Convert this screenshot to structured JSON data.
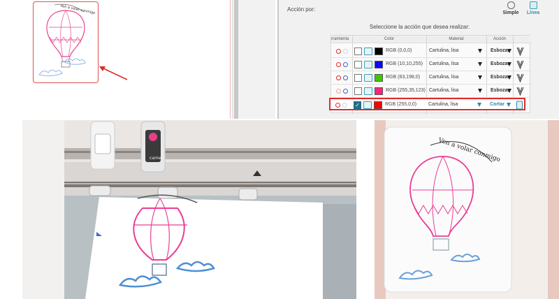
{
  "accent_colors": {
    "selection_red": "#e02a2a",
    "line_teal": "#2a8aa5",
    "pink_ink": "#e8448f",
    "blue_ink": "#4c8fd6"
  },
  "action_panel": {
    "label": "Acción por:",
    "modes": [
      {
        "label": "Simple",
        "icon": "circle-icon"
      },
      {
        "label": "Línea",
        "icon": "line-mode-icon",
        "active": true
      }
    ],
    "instruction": "Seleccione la acción que desea realizar:",
    "columns": [
      "rramienta",
      "Color",
      "Material",
      "Acción"
    ],
    "rows": [
      {
        "color_hex": "#000000",
        "rgb_label": "RGB (0,0,0)",
        "material": "Cartulina, lisa",
        "action": "Esbozar",
        "checked": false,
        "selected": false
      },
      {
        "color_hex": "#0a0aff",
        "rgb_label": "RGB (10,10,255)",
        "material": "Cartulina, lisa",
        "action": "Esbozar",
        "checked": false,
        "selected": false
      },
      {
        "color_hex": "#3fc600",
        "rgb_label": "RGB (63,198,0)",
        "material": "Cartulina, lisa",
        "action": "Esbozar",
        "checked": false,
        "selected": false
      },
      {
        "color_hex": "#ff237b",
        "rgb_label": "RGB (255,35,123)",
        "material": "Cartulina, lisa",
        "action": "Esbozar",
        "checked": false,
        "selected": false
      },
      {
        "color_hex": "#ff0000",
        "rgb_label": "RGB (255,0,0)",
        "material": "Cartulina, lisa",
        "action": "Cortar",
        "checked": true,
        "selected": true
      }
    ]
  },
  "design": {
    "balloon_text": "Ven a volar conmigo"
  },
  "machine_photo": {
    "brand_text": "cameo"
  }
}
